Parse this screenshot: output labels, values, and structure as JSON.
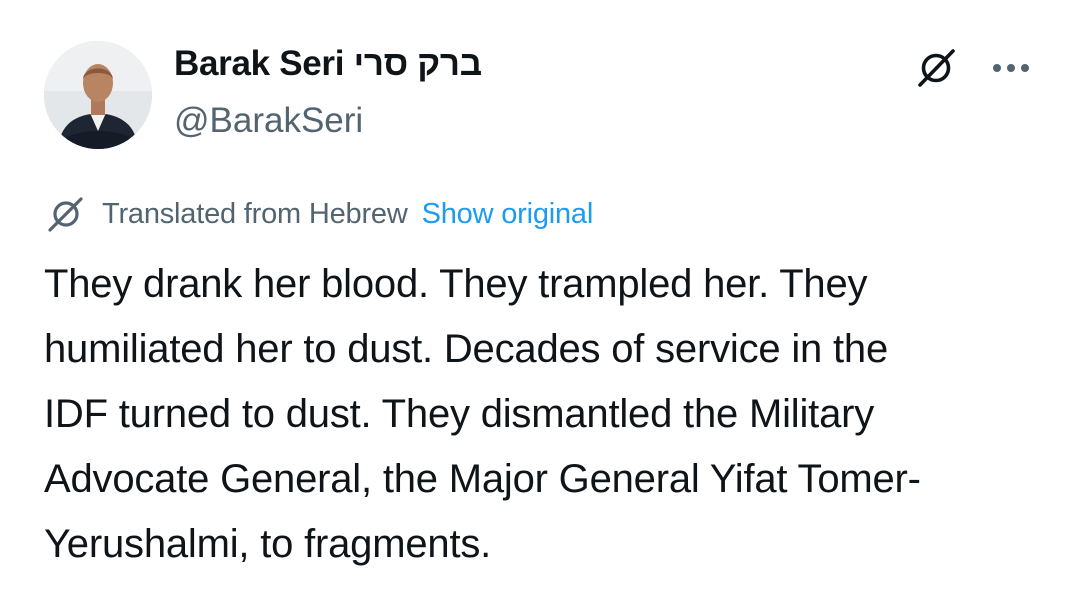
{
  "author": {
    "display_name": "Barak Seri ברק סרי",
    "handle": "@BarakSeri"
  },
  "header_actions": {
    "grok_icon": "grok-slash-circle-icon",
    "more_icon": "more-horizontal-icon"
  },
  "translation": {
    "icon": "grok-slash-circle-icon",
    "label": "Translated from Hebrew",
    "show_original": "Show original"
  },
  "tweet": {
    "text": "They drank her blood. They trampled her. They\nhumiliated her to dust. Decades of service in the\nIDF turned to dust. They dismantled the Military\nAdvocate General, the Major General Yifat Tomer-\nYerushalmi, to fragments."
  },
  "colors": {
    "text_primary": "#0f1419",
    "text_secondary": "#536471",
    "link": "#1d9bf0"
  }
}
